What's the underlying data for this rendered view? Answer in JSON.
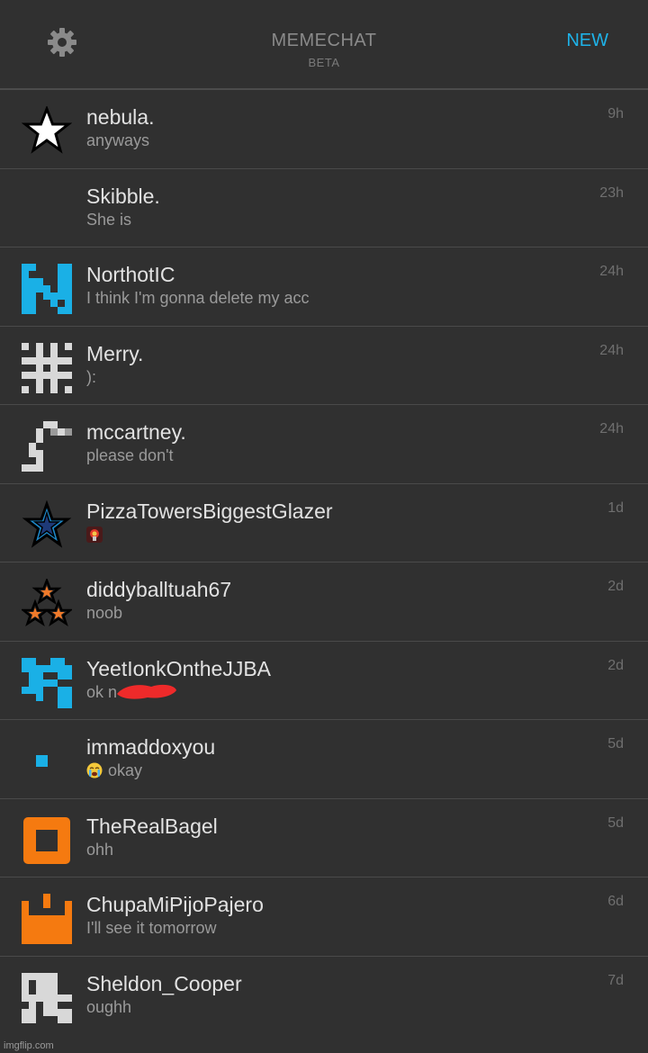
{
  "header": {
    "title": "MEMECHAT",
    "subtitle": "BETA",
    "new_label": "NEW",
    "settings_icon": "gear-icon",
    "accent_color": "#1eb2e8"
  },
  "conversations": [
    {
      "name": "nebula.",
      "message": "anyways",
      "time": "9h",
      "avatar": "white-star"
    },
    {
      "name": "Skibble.",
      "message": "She is",
      "time": "23h",
      "avatar": "none"
    },
    {
      "name": "NorthotIC",
      "message": "I think I'm gonna delete my acc",
      "time": "24h",
      "avatar": "blue-pixel-n"
    },
    {
      "name": "Merry.",
      "message": "):",
      "time": "24h",
      "avatar": "white-pixel-cross"
    },
    {
      "name": "mccartney.",
      "message": "please don't",
      "time": "24h",
      "avatar": "white-pixel-hook"
    },
    {
      "name": "PizzaTowersBiggestGlazer",
      "message": "",
      "time": "1d",
      "avatar": "blue-star",
      "message_emoji": "explosion-emoji"
    },
    {
      "name": "diddyballtuah67",
      "message": "noob",
      "time": "2d",
      "avatar": "three-orange-stars"
    },
    {
      "name": "YeetIonkOntheJJBA",
      "message": "ok n",
      "time": "2d",
      "avatar": "blue-pixel-blocks",
      "redacted": true
    },
    {
      "name": "immaddoxyou",
      "message": "okay",
      "time": "5d",
      "avatar": "blue-dot",
      "message_emoji": "crying-face-emoji"
    },
    {
      "name": "TheRealBagel",
      "message": "ohh",
      "time": "5d",
      "avatar": "orange-square"
    },
    {
      "name": "ChupaMiPijoPajero",
      "message": "I'll see it tomorrow",
      "time": "6d",
      "avatar": "orange-crown"
    },
    {
      "name": "Sheldon_Cooper",
      "message": "oughh",
      "time": "7d",
      "avatar": "white-pixel-skull"
    }
  ],
  "watermark": "imgflip.com"
}
